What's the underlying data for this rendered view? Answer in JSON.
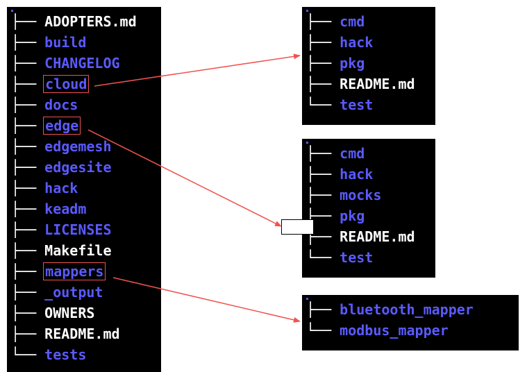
{
  "colors": {
    "background": "#000000",
    "directory": "#5a5aff",
    "file": "#ffffff",
    "highlight_border": "#ef5350",
    "arrow": "#ef5350"
  },
  "main_panel": {
    "items": [
      {
        "name": "ADOPTERS.md",
        "type": "file",
        "highlighted": false
      },
      {
        "name": "build",
        "type": "directory",
        "highlighted": false
      },
      {
        "name": "CHANGELOG",
        "type": "directory",
        "highlighted": false
      },
      {
        "name": "cloud",
        "type": "directory",
        "highlighted": true,
        "detail_index": 0
      },
      {
        "name": "docs",
        "type": "directory",
        "highlighted": false
      },
      {
        "name": "edge",
        "type": "directory",
        "highlighted": true,
        "detail_index": 1
      },
      {
        "name": "edgemesh",
        "type": "directory",
        "highlighted": false
      },
      {
        "name": "edgesite",
        "type": "directory",
        "highlighted": false
      },
      {
        "name": "hack",
        "type": "directory",
        "highlighted": false
      },
      {
        "name": "keadm",
        "type": "directory",
        "highlighted": false
      },
      {
        "name": "LICENSES",
        "type": "directory",
        "highlighted": false
      },
      {
        "name": "Makefile",
        "type": "file",
        "highlighted": false
      },
      {
        "name": "mappers",
        "type": "directory",
        "highlighted": true,
        "detail_index": 2
      },
      {
        "name": "_output",
        "type": "directory",
        "highlighted": false
      },
      {
        "name": "OWNERS",
        "type": "file",
        "highlighted": false
      },
      {
        "name": "README.md",
        "type": "file",
        "highlighted": false
      },
      {
        "name": "tests",
        "type": "directory",
        "highlighted": false
      }
    ]
  },
  "detail_panels": [
    {
      "source": "cloud",
      "items": [
        {
          "name": "cmd",
          "type": "directory"
        },
        {
          "name": "hack",
          "type": "directory"
        },
        {
          "name": "pkg",
          "type": "directory"
        },
        {
          "name": "README.md",
          "type": "file"
        },
        {
          "name": "test",
          "type": "directory"
        }
      ]
    },
    {
      "source": "edge",
      "items": [
        {
          "name": "cmd",
          "type": "directory"
        },
        {
          "name": "hack",
          "type": "directory"
        },
        {
          "name": "mocks",
          "type": "directory"
        },
        {
          "name": "pkg",
          "type": "directory"
        },
        {
          "name": "README.md",
          "type": "file"
        },
        {
          "name": "test",
          "type": "directory"
        }
      ]
    },
    {
      "source": "mappers",
      "items": [
        {
          "name": "bluetooth_mapper",
          "type": "directory"
        },
        {
          "name": "modbus_mapper",
          "type": "directory"
        }
      ]
    }
  ],
  "arrows": [
    {
      "from": "cloud",
      "to_panel_index": 0
    },
    {
      "from": "edge",
      "to_panel_index": 1
    },
    {
      "from": "mappers",
      "to_panel_index": 2
    }
  ]
}
